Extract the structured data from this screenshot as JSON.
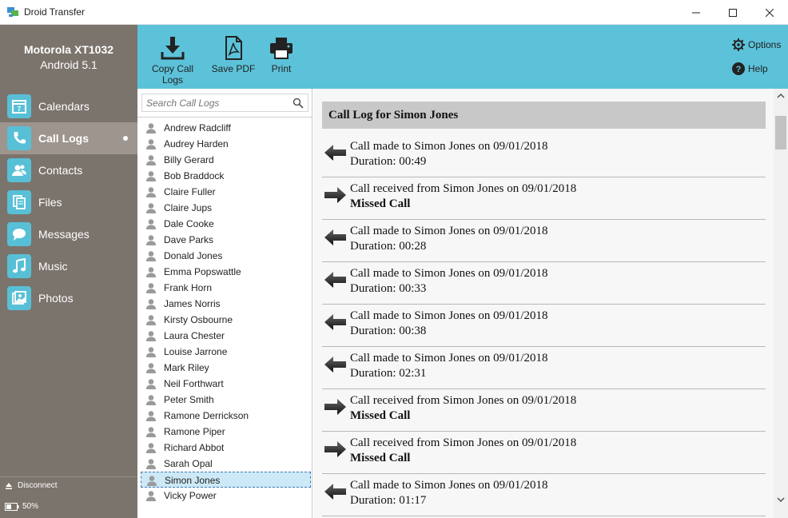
{
  "window": {
    "title": "Droid Transfer"
  },
  "device": {
    "name": "Motorola XT1032",
    "os": "Android 5.1"
  },
  "nav": [
    {
      "label": "Calendars",
      "icon": "calendar-icon",
      "active": false
    },
    {
      "label": "Call Logs",
      "icon": "phone-icon",
      "active": true
    },
    {
      "label": "Contacts",
      "icon": "contacts-icon",
      "active": false
    },
    {
      "label": "Files",
      "icon": "files-icon",
      "active": false
    },
    {
      "label": "Messages",
      "icon": "messages-icon",
      "active": false
    },
    {
      "label": "Music",
      "icon": "music-icon",
      "active": false
    },
    {
      "label": "Photos",
      "icon": "photos-icon",
      "active": false
    }
  ],
  "footer": {
    "disconnect_label": "Disconnect",
    "battery_label": "50%",
    "battery_level": 0.5
  },
  "toolbar": {
    "copy_label": "Copy Call Logs",
    "pdf_label": "Save PDF",
    "print_label": "Print",
    "options_label": "Options",
    "help_label": "Help"
  },
  "search": {
    "placeholder": "Search Call Logs",
    "value": ""
  },
  "contacts": [
    "Andrew Radcliff",
    "Audrey Harden",
    "Billy Gerard",
    "Bob Braddock",
    "Claire Fuller",
    "Claire Jups",
    "Dale Cooke",
    "Dave Parks",
    "Donald Jones",
    "Emma Popswattle",
    "Frank Horn",
    "James Norris",
    "Kirsty Osbourne",
    "Laura Chester",
    "Louise Jarrone",
    "Mark Riley",
    "Neil Forthwart",
    "Peter Smith",
    "Ramone Derrickson",
    "Ramone Piper",
    "Richard Abbot",
    "Sarah Opal",
    "Simon Jones",
    "Vicky Power"
  ],
  "selected_contact": "Simon Jones",
  "detail": {
    "title": "Call Log for Simon Jones",
    "entries": [
      {
        "direction": "outgoing",
        "text": "Call made to Simon Jones on 09/01/2018",
        "sub": "Duration: 00:49",
        "missed": false
      },
      {
        "direction": "incoming",
        "text": "Call received from Simon Jones on 09/01/2018",
        "sub": "Missed Call",
        "missed": true
      },
      {
        "direction": "outgoing",
        "text": "Call made to Simon Jones on 09/01/2018",
        "sub": "Duration: 00:28",
        "missed": false
      },
      {
        "direction": "outgoing",
        "text": "Call made to Simon Jones on 09/01/2018",
        "sub": "Duration: 00:33",
        "missed": false
      },
      {
        "direction": "outgoing",
        "text": "Call made to Simon Jones on 09/01/2018",
        "sub": "Duration: 00:38",
        "missed": false
      },
      {
        "direction": "outgoing",
        "text": "Call made to Simon Jones on 09/01/2018",
        "sub": "Duration: 02:31",
        "missed": false
      },
      {
        "direction": "incoming",
        "text": "Call received from Simon Jones on 09/01/2018",
        "sub": "Missed Call",
        "missed": true
      },
      {
        "direction": "incoming",
        "text": "Call received from Simon Jones on 09/01/2018",
        "sub": "Missed Call",
        "missed": true
      },
      {
        "direction": "outgoing",
        "text": "Call made to Simon Jones on 09/01/2018",
        "sub": "Duration: 01:17",
        "missed": false
      }
    ]
  },
  "colors": {
    "sidebar": "#7b746d",
    "sidebar_active": "#9d958e",
    "accent": "#5cc2d9",
    "detail_header": "#c8c8c8"
  }
}
